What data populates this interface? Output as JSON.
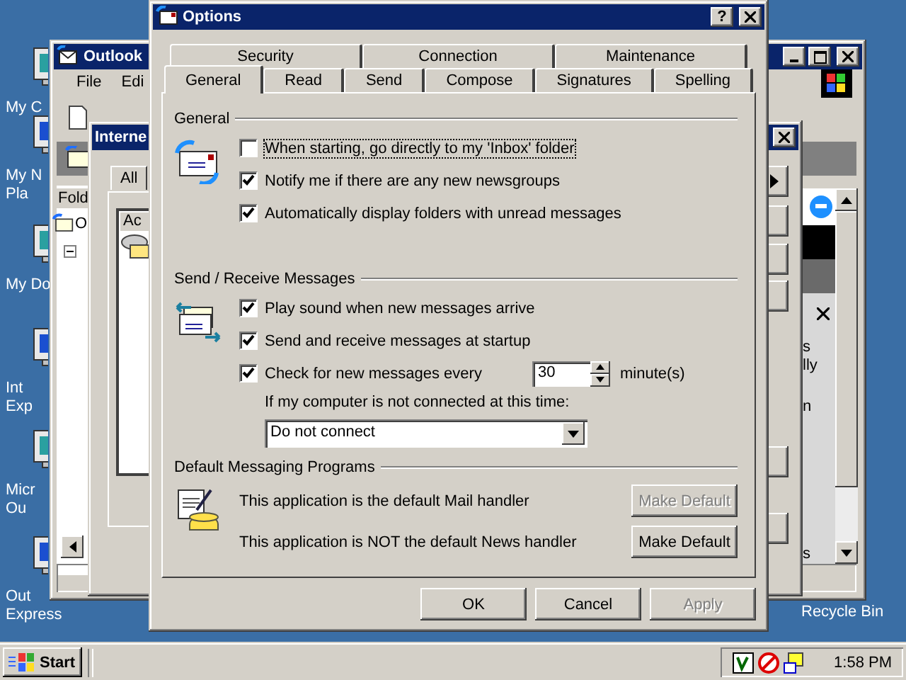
{
  "desktop": {
    "icons": [
      {
        "lines": [
          "My C"
        ]
      },
      {
        "lines": [
          "My N",
          "Pla"
        ]
      },
      {
        "lines": [
          "My Do"
        ]
      },
      {
        "lines": [
          "Int",
          "Exp"
        ]
      },
      {
        "lines": [
          "Micr",
          "Ou"
        ]
      },
      {
        "lines": [
          "Out",
          "Express"
        ]
      }
    ],
    "recycle_bin": "Recycle Bin"
  },
  "outlook_window": {
    "title": "Outlook",
    "menu": [
      "File",
      "Edi"
    ],
    "folder_header": "Fold",
    "tree_item": "O",
    "preview_fragments": [
      "s",
      "lly",
      "n",
      "s"
    ]
  },
  "accounts_window": {
    "title": "Interne",
    "tab": "All",
    "list_header": "Ac"
  },
  "options_dialog": {
    "title": "Options",
    "help": "?",
    "tab_rows": [
      [
        {
          "label": "Security",
          "selected": false
        },
        {
          "label": "Connection",
          "selected": false
        },
        {
          "label": "Maintenance",
          "selected": false
        }
      ],
      [
        {
          "label": "General",
          "selected": true
        },
        {
          "label": "Read",
          "selected": false
        },
        {
          "label": "Send",
          "selected": false
        },
        {
          "label": "Compose",
          "selected": false
        },
        {
          "label": "Signatures",
          "selected": false
        },
        {
          "label": "Spelling",
          "selected": false
        }
      ]
    ],
    "general": {
      "heading": "General",
      "options": [
        {
          "kind": "check",
          "label": "When starting, go directly to my 'Inbox' folder",
          "checked": false
        },
        {
          "kind": "check",
          "label": "Notify me if there are any new newsgroups",
          "checked": true
        },
        {
          "kind": "check",
          "label": "Automatically display folders with unread messages",
          "checked": true
        }
      ]
    },
    "send_receive": {
      "heading": "Send / Receive Messages",
      "options": [
        {
          "kind": "check",
          "label": "Play sound when new messages arrive",
          "checked": true
        },
        {
          "kind": "check",
          "label": "Send and receive messages at startup",
          "checked": true
        },
        {
          "kind": "interval",
          "label": "Check for new messages every",
          "checked": true,
          "value": "30",
          "unit": "minute(s)"
        }
      ],
      "connection_prompt": "If my computer is not connected at this time:",
      "connection_choice": "Do not connect"
    },
    "default_programs": {
      "heading": "Default Messaging Programs",
      "handlers": [
        {
          "text": "This application is the default Mail handler",
          "button": "Make Default",
          "disabled": true
        },
        {
          "text": "This application is NOT the default News handler",
          "button": "Make Default",
          "disabled": false
        }
      ]
    },
    "buttons": [
      {
        "label": "OK",
        "disabled": false
      },
      {
        "label": "Cancel",
        "disabled": false
      },
      {
        "label": "Apply",
        "disabled": true
      }
    ]
  },
  "taskbar": {
    "start": "Start",
    "clock": "1:58 PM"
  }
}
